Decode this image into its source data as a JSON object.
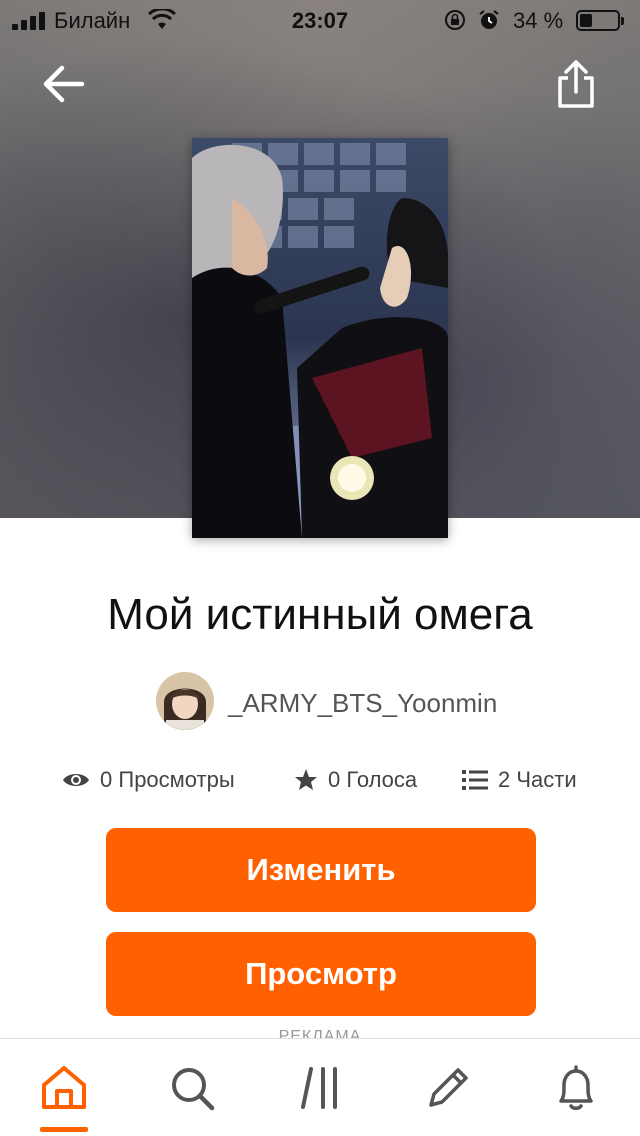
{
  "status_bar": {
    "carrier": "Билайн",
    "time": "23:07",
    "battery_percent_text": "34 %",
    "battery_level": 0.34
  },
  "story": {
    "title": "Мой истинный омега",
    "author": "_ARMY_BTS_Yoonmin"
  },
  "stats": {
    "views_count": "0",
    "views_label": "Просмотры",
    "votes_count": "0",
    "votes_label": "Голоса",
    "parts_count": "2",
    "parts_label": "Части"
  },
  "actions": {
    "edit_label": "Изменить",
    "view_label": "Просмотр"
  },
  "ad_label": "РЕКЛАМА",
  "tabs": [
    {
      "icon": "home-icon",
      "active": true
    },
    {
      "icon": "search-icon",
      "active": false
    },
    {
      "icon": "library-icon",
      "active": false
    },
    {
      "icon": "pencil-icon",
      "active": false
    },
    {
      "icon": "bell-icon",
      "active": false
    }
  ],
  "colors": {
    "accent": "#ff6100"
  }
}
